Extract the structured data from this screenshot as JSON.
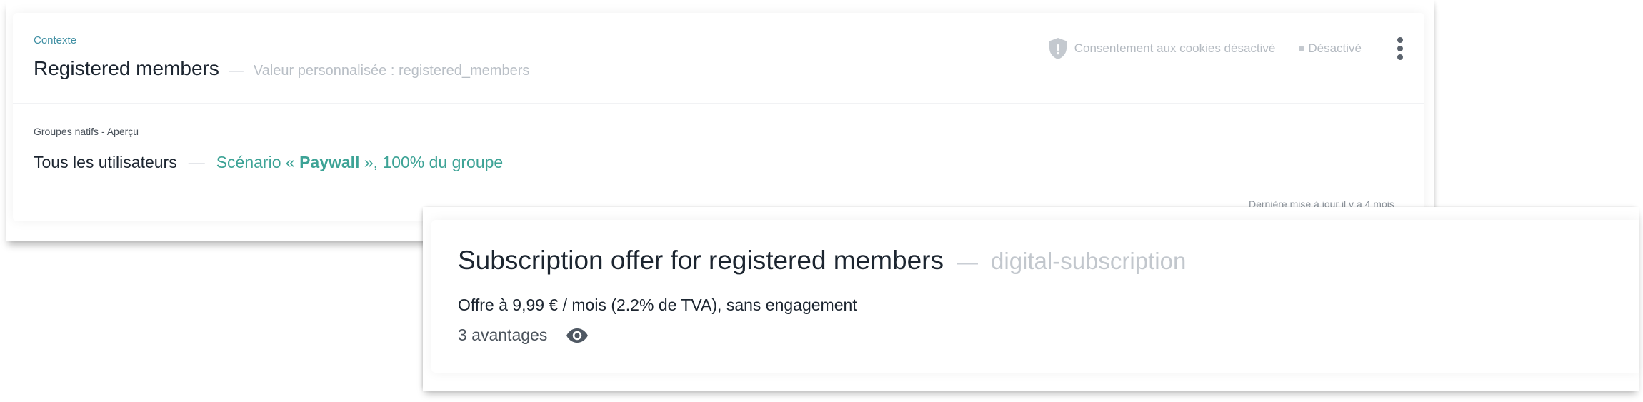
{
  "segment_card": {
    "context_label": "Contexte",
    "title": "Registered members",
    "separator": "—",
    "custom_value": "Valeur personnalisée : registered_members",
    "cookie_consent": {
      "icon": "shield-icon",
      "text": "Consentement aux cookies désactivé"
    },
    "status": "Désactivé",
    "menu_icon": "kebab-menu-icon",
    "groups_label": "Groupes natifs - Aperçu",
    "group": {
      "name": "Tous les utilisateurs",
      "separator": "—",
      "scenario_prefix": "Scénario « ",
      "scenario_name": "Paywall",
      "scenario_suffix": " », 100% du groupe"
    },
    "last_update": "Dernière mise à jour il y a 4 mois"
  },
  "offer_card": {
    "title": "Subscription offer for registered members",
    "separator": "—",
    "slug": "digital-subscription",
    "description": "Offre à 9,99 € / mois (2.2% de TVA), sans engagement",
    "benefits": "3 avantages",
    "preview_icon": "eye-icon"
  },
  "colors": {
    "accent_teal": "#3da396",
    "context_blue": "#3f8fa3",
    "text_dark": "#1c2530",
    "text_muted": "#b4bac1"
  }
}
